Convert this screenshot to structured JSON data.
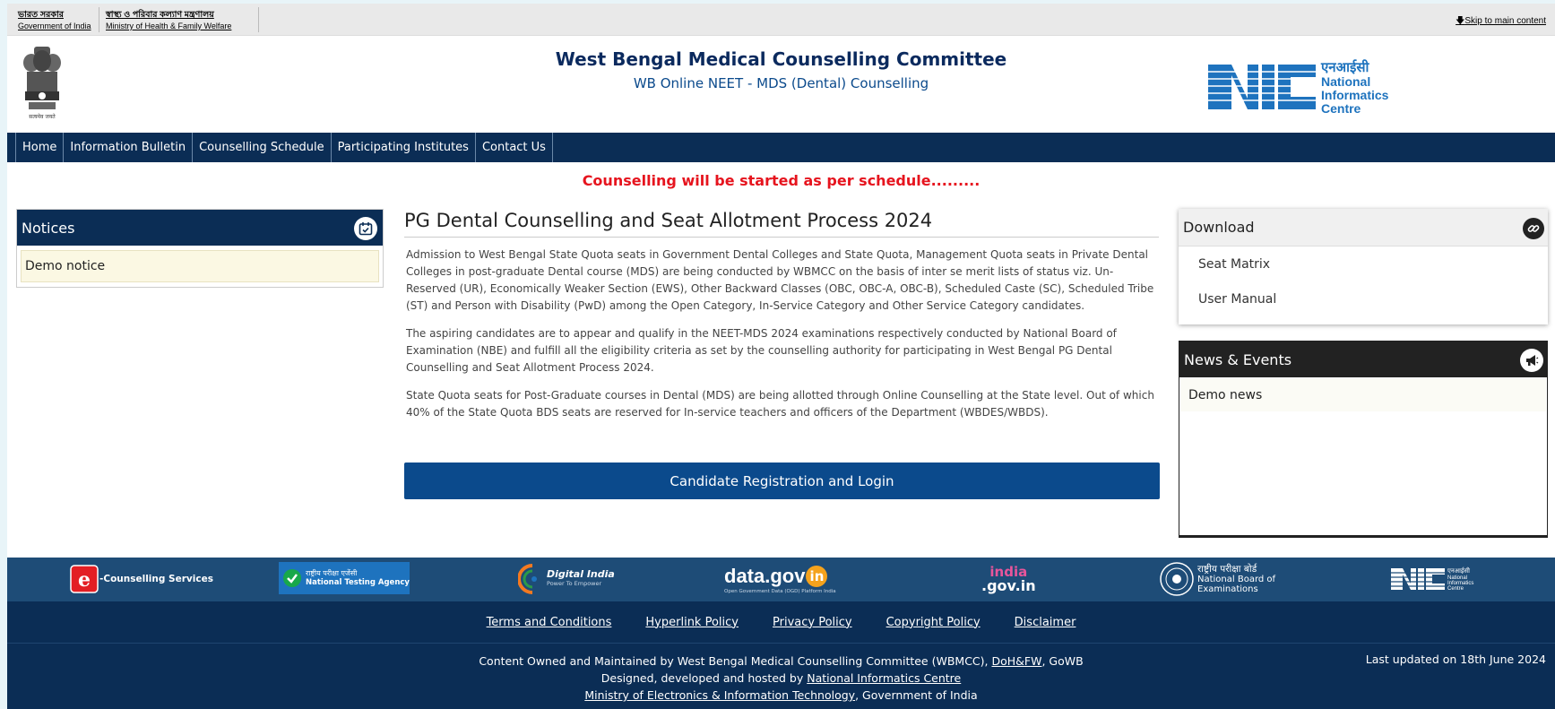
{
  "topbar": {
    "gov_local": "ভারত সরকার",
    "gov_en": "Government of India",
    "ministry_local": "স্বাস্থ্য ও পরিবার কল্যাণ মন্ত্রণালয়",
    "ministry_en": "Ministry of Health & Family Welfare",
    "skip": "Skip to main content"
  },
  "header": {
    "emblem_caption": "सत्यमेव जयते",
    "title": "West Bengal Medical Counselling Committee",
    "subtitle": "WB Online NEET - MDS (Dental) Counselling",
    "nic_hindi": "एनआईसी",
    "nic_line1": "National",
    "nic_line2": "Informatics",
    "nic_line3": "Centre"
  },
  "nav": {
    "items": [
      "Home",
      "Information Bulletin",
      "Counselling Schedule",
      "Participating Institutes",
      "Contact Us"
    ]
  },
  "marquee": "Counselling will be started as per schedule.........",
  "notices": {
    "title": "Notices",
    "items": [
      "Demo notice"
    ]
  },
  "main": {
    "title": "PG Dental Counselling and Seat Allotment Process 2024",
    "paragraphs": [
      "Admission to West Bengal State Quota seats in Government Dental Colleges and State Quota, Management Quota seats in Private Dental Colleges in post-graduate Dental course (MDS) are being conducted by WBMCC on the basis of inter se merit lists of status viz. Un-Reserved (UR), Economically Weaker Section (EWS), Other Backward Classes (OBC, OBC-A, OBC-B), Scheduled Caste (SC), Scheduled Tribe (ST) and Person with Disability (PwD) among the Open Category, In-Service Category and Other Service Category candidates.",
      "The aspiring candidates are to appear and qualify in the NEET-MDS 2024 examinations respectively conducted by National Board of Examination (NBE) and fulfill all the eligibility criteria as set by the counselling authority for participating in West Bengal PG Dental Counselling and Seat Allotment Process 2024.",
      "State Quota seats for Post-Graduate courses in Dental (MDS) are being allotted through Online Counselling at the State level. Out of which 40% of the State Quota BDS seats are reserved for In-service teachers and officers of the Department (WBDES/WBDS)."
    ],
    "register_button": "Candidate Registration and Login"
  },
  "download": {
    "title": "Download",
    "items": [
      "Seat Matrix",
      "User Manual"
    ]
  },
  "news": {
    "title": "News & Events",
    "items": [
      "Demo news"
    ]
  },
  "footer": {
    "logos": {
      "counselling": "-Counselling Services",
      "nta_hindi": "राष्ट्रीय परीक्षा एजेंसी",
      "nta_en": "National Testing Agency",
      "digital_india": "Digital India",
      "digital_india_tag": "Power To Empower",
      "datagov": "data.gov",
      "datagov_in": "in",
      "datagov_tag": "Open Government Data (OGD) Platform India",
      "indiagov_top": "india",
      "indiagov_bottom": ".gov.in",
      "nbe_hindi": "राष्ट्रीय परीक्षा बोर्ड",
      "nbe_en1": "National Board of",
      "nbe_en2": "Examinations",
      "nic_hindi": "एनआईसी",
      "nic_line1": "National",
      "nic_line2": "Informatics",
      "nic_line3": "Centre"
    },
    "links": [
      "Terms and Conditions",
      "Hyperlink Policy",
      "Privacy Policy",
      "Copyright Policy",
      "Disclaimer"
    ],
    "owned_prefix": "Content Owned and Maintained by West Bengal Medical Counselling Committee (WBMCC), ",
    "owned_link": "DoH&FW",
    "owned_suffix": ", GoWB",
    "designed_prefix": "Designed, developed and hosted by ",
    "designed_link": "National Informatics Centre",
    "ministry_link": "Ministry of Electronics & Information Technology",
    "ministry_suffix": ", Government of India",
    "updated": "Last updated on 18th June 2024"
  },
  "colors": {
    "navy": "#0b2d55",
    "button_blue": "#0b4a8c",
    "marquee_red": "#e6141e",
    "footer_strip": "#1e4c77"
  }
}
